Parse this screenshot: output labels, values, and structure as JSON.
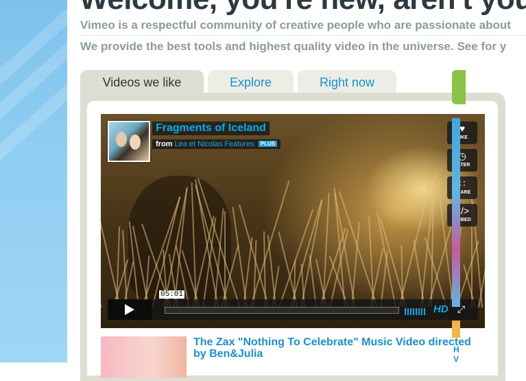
{
  "header": {
    "headline": "Welcome, you're new, aren't you?",
    "line1": "Vimeo is a respectful community of creative people who are passionate about",
    "line2": "We provide the best tools and highest quality video in the universe. See for y"
  },
  "tabs": [
    {
      "label": "Videos we like",
      "active": true
    },
    {
      "label": "Explore",
      "active": false
    },
    {
      "label": "Right now",
      "active": false
    }
  ],
  "video": {
    "title": "Fragments of Iceland",
    "from_label": "from",
    "author": "Lea et Nicolas Features",
    "badge": "PLUS",
    "actions": [
      {
        "icon": "heart-icon",
        "label": "LIKE"
      },
      {
        "icon": "clock-icon",
        "label": "LATER"
      },
      {
        "icon": "share-icon",
        "label": "SHARE"
      },
      {
        "icon": "embed-icon",
        "label": "EMBED"
      }
    ],
    "timecode": "05:01",
    "hd_label": "HD"
  },
  "next_video": {
    "title": "The Zax \"Nothing To Celebrate\" Music Video directed by Ben&Julia"
  },
  "right_column": {
    "text": "H\nV"
  },
  "colors": {
    "accent": "#00adef",
    "link": "#1a8fd0",
    "tab_bg": "#dcded2"
  }
}
